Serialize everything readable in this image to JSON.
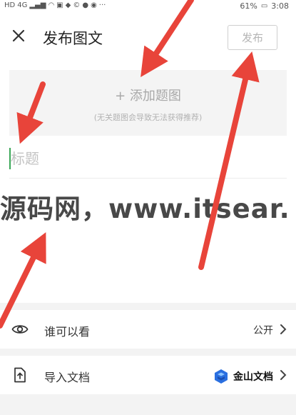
{
  "status_bar": {
    "left_badges": [
      "HD",
      "4G"
    ],
    "battery": "61%",
    "time": "3:08"
  },
  "header": {
    "title": "发布图文",
    "publish_label": "发布"
  },
  "cover": {
    "add_label": "+ 添加题图",
    "hint": "(无关题图会导致无法获得推荐)"
  },
  "title_field": {
    "placeholder": "标题"
  },
  "watermark": "源码网，www.itsear.",
  "rows": {
    "visibility": {
      "label": "谁可以看",
      "value": "公开"
    },
    "import": {
      "label": "导入文档",
      "brand": "金山文档"
    }
  },
  "colors": {
    "arrow": "#e8443a",
    "caret": "#3aa757",
    "brand": "#2a6fe0"
  }
}
